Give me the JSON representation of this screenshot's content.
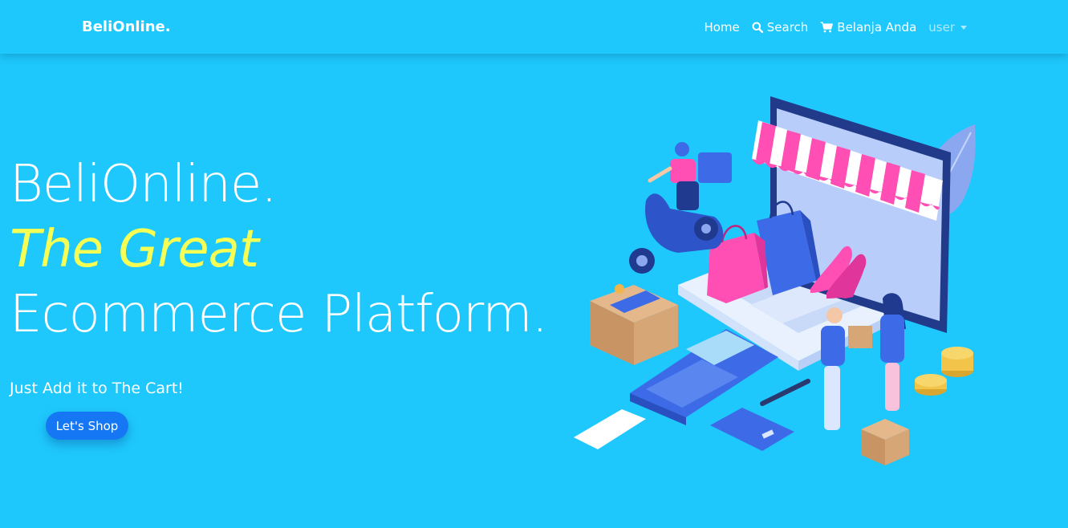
{
  "navbar": {
    "brand": "BeliOnline.",
    "links": [
      {
        "label": "Home",
        "icon": null
      },
      {
        "label": "Search",
        "icon": "search-icon"
      },
      {
        "label": "Belanja Anda",
        "icon": "cart-icon"
      }
    ],
    "user_menu": {
      "label": "user",
      "icon": "caret-down-icon"
    }
  },
  "hero": {
    "line1": "BeliOnline.",
    "line2": "The Great",
    "line3": "Ecommerce Platform.",
    "tagline": "Just Add it to The Cart!",
    "cta_label": "Let's Shop"
  },
  "colors": {
    "background": "#1ec8fc",
    "highlight": "#f6ff54",
    "cta": "#1677f5",
    "awning_pink": "#ff4fb4",
    "accent_blue": "#3d6be8"
  },
  "illustration": {
    "icon": "ecommerce-isometric-illustration"
  }
}
